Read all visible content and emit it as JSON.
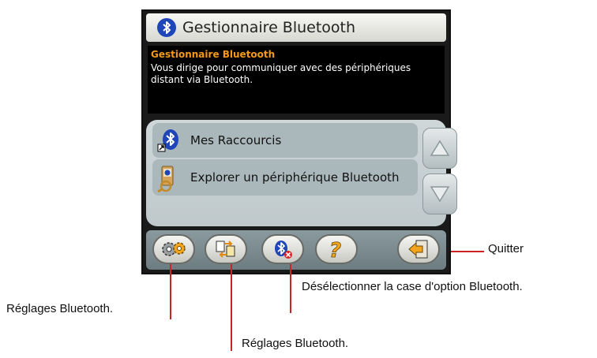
{
  "window": {
    "title": "Gestionnaire Bluetooth",
    "title_icon": "bluetooth-icon"
  },
  "description": {
    "heading": "Gestionnaire Bluetooth",
    "body": "Vous dirige pour communiquer avec des périphériques distant via Bluetooth.",
    "heading_color": "#f59a16"
  },
  "list": {
    "items": [
      {
        "label": "Mes Raccourcis",
        "icon": "bluetooth-shortcut-icon"
      },
      {
        "label": "Explorer un périphérique Bluetooth",
        "icon": "explore-device-icon"
      }
    ],
    "scroll_up_icon": "arrow-up-icon",
    "scroll_down_icon": "arrow-down-icon"
  },
  "toolbar": {
    "buttons": [
      {
        "icon": "settings-gears-icon"
      },
      {
        "icon": "file-transfer-icon"
      },
      {
        "icon": "bluetooth-disable-icon"
      },
      {
        "icon": "help-icon"
      },
      {
        "icon": "exit-icon"
      }
    ]
  },
  "annotations": {
    "quit": "Quitter",
    "deselect": "Désélectionner la case d'option Bluetooth.",
    "settings_left": "Réglages Bluetooth.",
    "settings_bottom": "Réglages Bluetooth.",
    "line_color": "#cc2222"
  }
}
